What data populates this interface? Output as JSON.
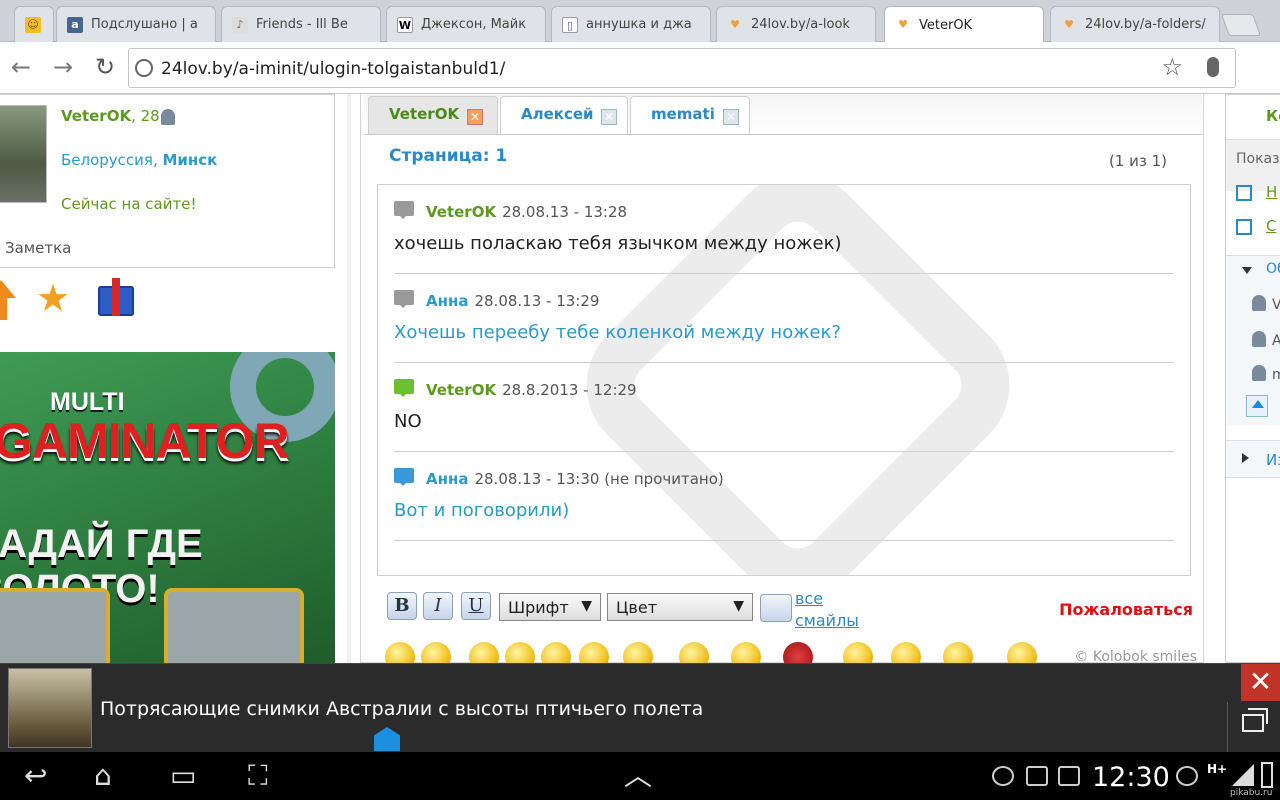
{
  "browser": {
    "tabs": [
      {
        "title": "",
        "favicon": "☺",
        "favicon_bg": "#f0c020"
      },
      {
        "title": "Подслушано | а",
        "favicon": "a",
        "favicon_bg": "#45668e"
      },
      {
        "title": "Friends - Ill Be",
        "favicon": "♪",
        "favicon_bg": "#888888"
      },
      {
        "title": "Джексон, Майк",
        "favicon": "W",
        "favicon_bg": "#ffffff"
      },
      {
        "title": "аннушка и джа",
        "favicon": "▯",
        "favicon_bg": "#ffffff"
      },
      {
        "title": "24lov.by/a-look",
        "favicon": "♥",
        "favicon_bg": "#f0a040"
      },
      {
        "title": "VeterOK",
        "favicon": "♥",
        "favicon_bg": "#f0a040"
      },
      {
        "title": "24lov.by/a-folders/",
        "favicon": "♥",
        "favicon_bg": "#f0a040"
      }
    ],
    "url": "24lov.by/a-iminit/ulogin-tolgaistanbuld1/"
  },
  "profile": {
    "name": "VeterOK",
    "age": ", 28",
    "country": "Белоруссия, ",
    "city": "Минск",
    "status": "Сейчас на сайте!",
    "note": "Заметка"
  },
  "ad_banner": {
    "line1": "MULTI",
    "line2": "GAMINATOR",
    "line3": "ГАДАЙ ГДЕ ЗОЛОТО!"
  },
  "chat": {
    "tabs": [
      {
        "label": "VeterOK",
        "active": true
      },
      {
        "label": "Алексей",
        "active": false
      },
      {
        "label": "memati",
        "active": false
      }
    ],
    "page_title": "Страница: 1",
    "page_info": "(1 из 1)",
    "messages": [
      {
        "author": "VeterOK",
        "author_color": "#5c9a1e",
        "icon_color": "#9a9a9a",
        "date": "28.08.13 - 13:28",
        "text": "хочешь поласкаю тебя язычком между ножек)",
        "text_color": "#222222"
      },
      {
        "author": "Анна",
        "author_color": "#2a9ac8",
        "icon_color": "#9a9a9a",
        "date": "28.08.13 - 13:29",
        "text": "Хочешь переебу тебе коленкой между ножек?",
        "text_color": "#2a9ac8"
      },
      {
        "author": "VeterOK",
        "author_color": "#5c9a1e",
        "icon_color": "#6cc030",
        "date": "28.8.2013 - 12:29",
        "text": "NO",
        "text_color": "#222222"
      },
      {
        "author": "Анна",
        "author_color": "#2a9ac8",
        "icon_color": "#3a9ad8",
        "date": "28.08.13 - 13:30 (не прочитано)",
        "text": "Вот и поговорили)",
        "text_color": "#2a9ac8"
      }
    ]
  },
  "editor": {
    "bold": "B",
    "italic": "I",
    "underline": "U",
    "font_select": "Шрифт",
    "color_select": "Цвет",
    "all_smiles_1": "все",
    "all_smiles_2": "смайлы",
    "complain": "Пожаловаться",
    "credit": "© Kolobok smiles"
  },
  "right_panel": {
    "title_fragment": "Ко",
    "show_label": "Показ",
    "option1": "Н",
    "option2": "С",
    "group_fragment": "Об",
    "users": [
      "V",
      "А",
      "m"
    ],
    "bottom_fragment": "Из"
  },
  "notification": {
    "text": "Потрясающие снимки Австралии с высоты птичьего полета",
    "close": "✕"
  },
  "status_bar": {
    "time": "12:30",
    "network": "H+",
    "watermark": "pikabu.ru"
  }
}
